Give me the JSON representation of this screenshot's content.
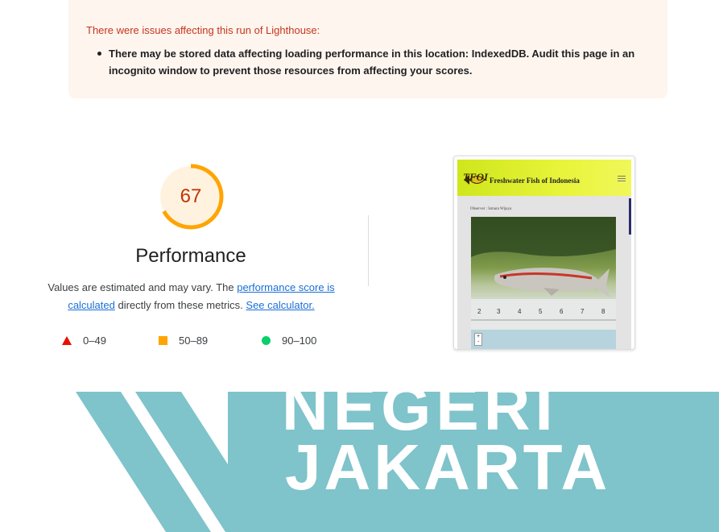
{
  "warning": {
    "title": "There were issues affecting this run of Lighthouse:",
    "item": "There may be stored data affecting loading performance in this location: IndexedDB. Audit this page in an incognito window to prevent those resources from affecting your scores."
  },
  "performance": {
    "score": "67",
    "score_fraction": 0.67,
    "title": "Performance",
    "desc_prefix": "Values are estimated and may vary. The ",
    "desc_link1": "performance score is calculated",
    "desc_middle": " directly from these metrics. ",
    "desc_link2": "See calculator.",
    "gauge_color": "#ffa400",
    "gauge_bg": "#fff3e0"
  },
  "legend": [
    {
      "range": "0–49",
      "color": "#eb0f00",
      "icon": "triangle-icon"
    },
    {
      "range": "50–89",
      "color": "#ffa400",
      "icon": "square-icon"
    },
    {
      "range": "90–100",
      "color": "#0cce6b",
      "icon": "circle-icon"
    }
  ],
  "screenshot": {
    "logo_text": "TFOI",
    "site_title": "Freshwater Fish of Indonesia",
    "observer": "Observer : Ismara Wijaya",
    "zoom_in": "+",
    "zoom_out": "-"
  },
  "banner": {
    "line1": "NEGERI",
    "line2": "JAKARTA",
    "color": "#7fc3cb"
  }
}
